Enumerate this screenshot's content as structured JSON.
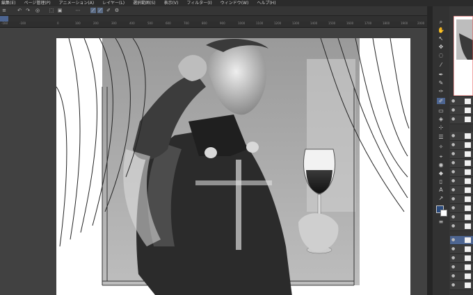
{
  "menu": {
    "items": [
      "編集(E)",
      "ページ管理(P)",
      "アニメーション(A)",
      "レイヤー(L)",
      "選択範囲(S)",
      "表示(V)",
      "フィルター(I)",
      "ウィンドウ(W)",
      "ヘルプ(H)"
    ]
  },
  "commandbar": {
    "icons": [
      "menu-icon",
      "undo-icon",
      "redo-icon",
      "clear-icon",
      "fill-icon",
      "transform-icon",
      "snap-icon",
      "ruler-snap-icon",
      "special-ruler-icon",
      "settings-icon"
    ]
  },
  "ruler": {
    "labels": [
      "-160",
      "-100",
      "0",
      "100",
      "200",
      "300",
      "400",
      "500",
      "600",
      "700",
      "800",
      "900",
      "1000",
      "1100",
      "1200",
      "1300",
      "1400",
      "1500",
      "1600",
      "1700",
      "1800",
      "1900",
      "2000",
      "2100"
    ]
  },
  "tools": {
    "glyphs": [
      "⌕",
      "✋",
      "↖",
      "✥",
      "◌",
      "⁄",
      "✒",
      "✎",
      "✑",
      "✐",
      "▭",
      "◈",
      "⊹",
      "☰",
      "✧",
      "⌖",
      "◉",
      "◆",
      "▯",
      "A",
      "↗",
      "≡"
    ],
    "names": [
      "zoom-icon",
      "hand-icon",
      "operation-icon",
      "move-layer-icon",
      "lasso-icon",
      "eyedropper-icon",
      "pen-icon",
      "pencil-icon",
      "brush-icon",
      "airbrush-icon",
      "eraser-icon",
      "blend-icon",
      "decoration-icon",
      "fill-icon",
      "gradient-icon",
      "figure-icon",
      "ellipse-icon",
      "frame-icon",
      "ruler-icon",
      "text-icon",
      "balloon-icon",
      "correct-line-icon"
    ]
  },
  "colors": {
    "accent": "#4d6591",
    "main_color": "#2a4a7c",
    "sub_color": "#ffffff"
  }
}
